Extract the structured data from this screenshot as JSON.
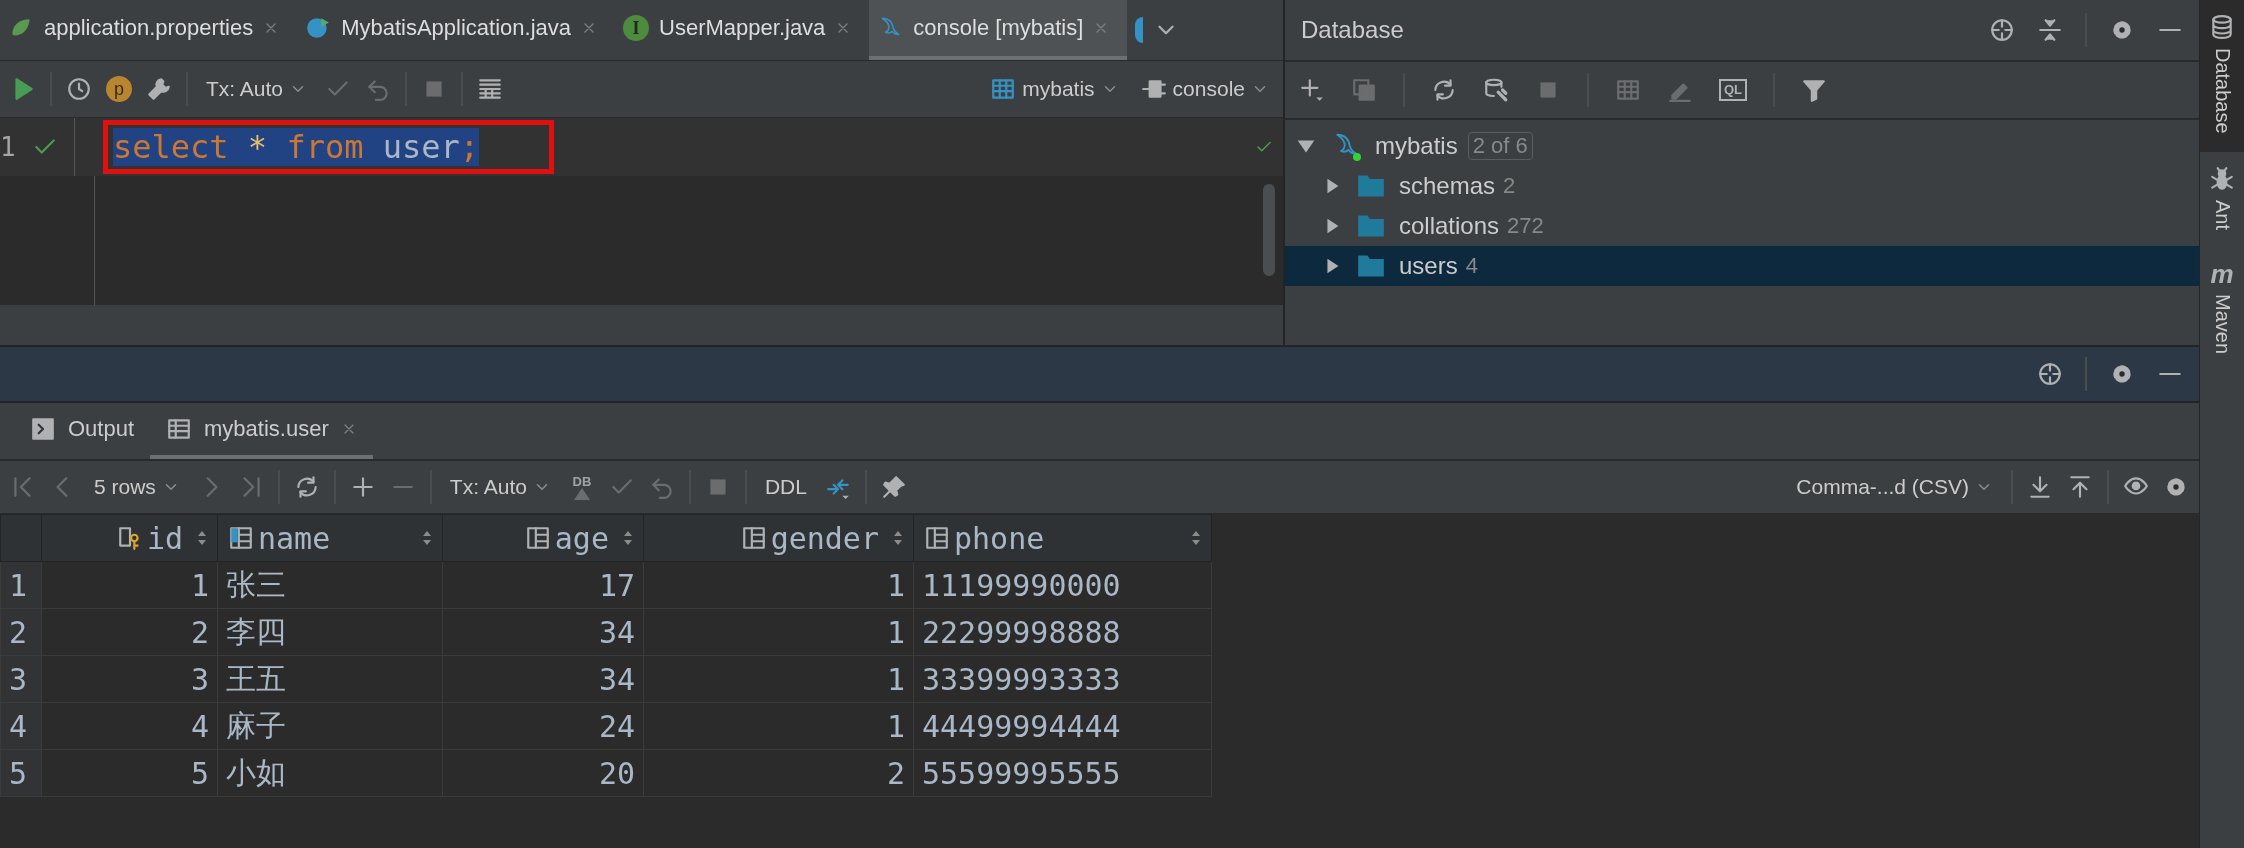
{
  "editor_tabs": [
    {
      "label": "application.properties",
      "kind": "spring",
      "selected": false
    },
    {
      "label": "MybatisApplication.java",
      "kind": "app",
      "selected": false
    },
    {
      "label": "UserMapper.java",
      "kind": "interface",
      "icon_letter": "I",
      "selected": false
    },
    {
      "label": "console [mybatis]",
      "kind": "dolphin",
      "selected": true
    }
  ],
  "editor_toolbar": {
    "items": [
      {
        "kind": "run",
        "disabled": false
      },
      {
        "kind": "divider"
      },
      {
        "kind": "history",
        "disabled": false
      },
      {
        "kind": "badge",
        "label": "p"
      },
      {
        "kind": "wrench",
        "disabled": false
      },
      {
        "kind": "divider"
      },
      {
        "kind": "dropdown",
        "label": "Tx: Auto"
      },
      {
        "kind": "check",
        "disabled": true
      },
      {
        "kind": "undo",
        "disabled": true
      },
      {
        "kind": "divider"
      },
      {
        "kind": "stop",
        "disabled": true
      },
      {
        "kind": "divider"
      },
      {
        "kind": "layout",
        "disabled": false
      }
    ],
    "datasource": "mybatis",
    "session": "console"
  },
  "editor": {
    "lines": [
      {
        "number": "1",
        "ok": true,
        "tokens": [
          {
            "text": "select ",
            "kind": "keyword"
          },
          {
            "text": "* ",
            "kind": "operator"
          },
          {
            "text": "from ",
            "kind": "keyword"
          },
          {
            "text": "user",
            "kind": "identifier"
          },
          {
            "text": ";",
            "kind": "keyword"
          }
        ]
      }
    ]
  },
  "database_panel": {
    "title": "Database",
    "toolbar": [
      {
        "kind": "add",
        "disabled": false
      },
      {
        "kind": "copy",
        "disabled": true
      },
      {
        "kind": "divider"
      },
      {
        "kind": "refresh",
        "disabled": false
      },
      {
        "kind": "dbwrench",
        "disabled": false
      },
      {
        "kind": "stop",
        "disabled": true
      },
      {
        "kind": "divider"
      },
      {
        "kind": "grid",
        "disabled": true
      },
      {
        "kind": "edit",
        "disabled": true
      },
      {
        "kind": "ql",
        "label": "QL"
      },
      {
        "kind": "divider"
      },
      {
        "kind": "filter",
        "disabled": false
      }
    ],
    "tree": [
      {
        "label": "mybatis",
        "badge": "2 of 6",
        "expanded": true,
        "selected": false,
        "children": [
          {
            "label": "schemas",
            "count": "2",
            "expanded": false,
            "selected": false
          },
          {
            "label": "collations",
            "count": "272",
            "expanded": false,
            "selected": false
          },
          {
            "label": "users",
            "count": "4",
            "expanded": false,
            "selected": true
          }
        ]
      }
    ]
  },
  "side_tools": [
    {
      "label": "Database",
      "kind": "database",
      "selected": true
    },
    {
      "label": "Ant",
      "kind": "ant",
      "selected": false
    },
    {
      "label": "Maven",
      "kind": "maven",
      "icon_letter": "m",
      "selected": false
    }
  ],
  "results_panel": {
    "tabs": [
      {
        "label": "Output",
        "kind": "terminal",
        "selected": false
      },
      {
        "label": "mybatis.user",
        "kind": "table",
        "selected": true
      }
    ],
    "toolbar": [
      {
        "kind": "first",
        "disabled": true
      },
      {
        "kind": "prev",
        "disabled": true
      },
      {
        "kind": "dropdown",
        "label": "5 rows"
      },
      {
        "kind": "next",
        "disabled": true
      },
      {
        "kind": "last",
        "disabled": true
      },
      {
        "kind": "divider"
      },
      {
        "kind": "refresh",
        "disabled": false
      },
      {
        "kind": "divider"
      },
      {
        "kind": "plus",
        "disabled": false
      },
      {
        "kind": "minus",
        "disabled": true
      },
      {
        "kind": "divider"
      },
      {
        "kind": "dropdown",
        "label": "Tx: Auto"
      },
      {
        "kind": "dbup",
        "label": "DB"
      },
      {
        "kind": "check",
        "disabled": true
      },
      {
        "kind": "undo",
        "disabled": true
      },
      {
        "kind": "divider"
      },
      {
        "kind": "stop",
        "disabled": true
      },
      {
        "kind": "divider"
      },
      {
        "kind": "text",
        "label": "DDL"
      },
      {
        "kind": "compare",
        "disabled": false
      },
      {
        "kind": "divider"
      },
      {
        "kind": "pin",
        "disabled": false
      }
    ],
    "export_format": "Comma-...d (CSV)",
    "table": {
      "columns": [
        {
          "name": "id",
          "kind": "number",
          "key": true
        },
        {
          "name": "name",
          "kind": "text",
          "key": false
        },
        {
          "name": "age",
          "kind": "number",
          "key": false
        },
        {
          "name": "gender",
          "kind": "number",
          "key": false
        },
        {
          "name": "phone",
          "kind": "text",
          "key": false
        }
      ],
      "rows": [
        {
          "number": "1",
          "cells": [
            "1",
            "张三",
            "17",
            "1",
            "11199990000"
          ]
        },
        {
          "number": "2",
          "cells": [
            "2",
            "李四",
            "34",
            "1",
            "22299998888"
          ]
        },
        {
          "number": "3",
          "cells": [
            "3",
            "王五",
            "34",
            "1",
            "33399993333"
          ]
        },
        {
          "number": "4",
          "cells": [
            "4",
            "麻子",
            "24",
            "1",
            "44499994444"
          ]
        },
        {
          "number": "5",
          "cells": [
            "5",
            "小如",
            "20",
            "2",
            "55599995555"
          ]
        }
      ]
    }
  }
}
